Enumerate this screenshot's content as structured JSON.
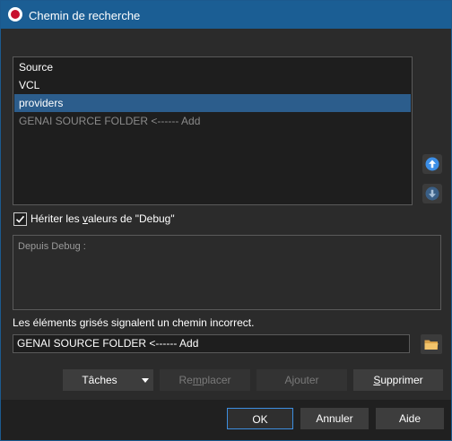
{
  "window": {
    "title": "Chemin de recherche",
    "icon": "delphi-app-icon"
  },
  "path_list": {
    "items": [
      {
        "label": "Source",
        "state": "normal"
      },
      {
        "label": "VCL",
        "state": "normal"
      },
      {
        "label": "providers",
        "state": "selected"
      },
      {
        "label": "GENAI SOURCE FOLDER <------ Add",
        "state": "greyed"
      }
    ]
  },
  "side_buttons": {
    "up_icon": "arrow-up-icon",
    "down_icon": "arrow-down-icon"
  },
  "inherit": {
    "checked": true,
    "prefix": "Hériter les ",
    "accel": "v",
    "suffix": "aleurs de \"Debug\""
  },
  "inherited_box": {
    "label": "Depuis Debug :"
  },
  "hint_text": "Les éléments grisés signalent un chemin incorrect.",
  "path_input": {
    "value": "GENAI SOURCE FOLDER <------ Add"
  },
  "actions": {
    "taches": "Tâches",
    "remplacer_a": "Re",
    "remplacer_u": "m",
    "remplacer_b": "placer",
    "ajouter": "Ajouter",
    "supprimer_u": "S",
    "supprimer_b": "upprimer"
  },
  "footer": {
    "ok": "OK",
    "cancel": "Annuler",
    "help": "Aide"
  },
  "colors": {
    "titlebar": "#1b5e94",
    "selection": "#2c5d8c",
    "accent_blue": "#3d8ee0"
  }
}
